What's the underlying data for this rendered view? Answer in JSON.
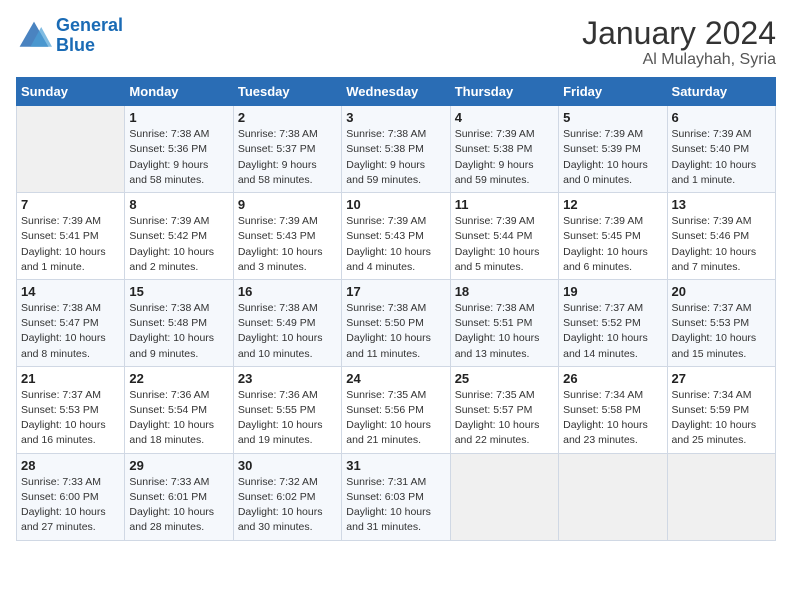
{
  "logo": {
    "line1": "General",
    "line2": "Blue"
  },
  "title": "January 2024",
  "location": "Al Mulayhah, Syria",
  "days_of_week": [
    "Sunday",
    "Monday",
    "Tuesday",
    "Wednesday",
    "Thursday",
    "Friday",
    "Saturday"
  ],
  "weeks": [
    [
      {
        "day": "",
        "info": ""
      },
      {
        "day": "1",
        "info": "Sunrise: 7:38 AM\nSunset: 5:36 PM\nDaylight: 9 hours\nand 58 minutes."
      },
      {
        "day": "2",
        "info": "Sunrise: 7:38 AM\nSunset: 5:37 PM\nDaylight: 9 hours\nand 58 minutes."
      },
      {
        "day": "3",
        "info": "Sunrise: 7:38 AM\nSunset: 5:38 PM\nDaylight: 9 hours\nand 59 minutes."
      },
      {
        "day": "4",
        "info": "Sunrise: 7:39 AM\nSunset: 5:38 PM\nDaylight: 9 hours\nand 59 minutes."
      },
      {
        "day": "5",
        "info": "Sunrise: 7:39 AM\nSunset: 5:39 PM\nDaylight: 10 hours\nand 0 minutes."
      },
      {
        "day": "6",
        "info": "Sunrise: 7:39 AM\nSunset: 5:40 PM\nDaylight: 10 hours\nand 1 minute."
      }
    ],
    [
      {
        "day": "7",
        "info": "Sunrise: 7:39 AM\nSunset: 5:41 PM\nDaylight: 10 hours\nand 1 minute."
      },
      {
        "day": "8",
        "info": "Sunrise: 7:39 AM\nSunset: 5:42 PM\nDaylight: 10 hours\nand 2 minutes."
      },
      {
        "day": "9",
        "info": "Sunrise: 7:39 AM\nSunset: 5:43 PM\nDaylight: 10 hours\nand 3 minutes."
      },
      {
        "day": "10",
        "info": "Sunrise: 7:39 AM\nSunset: 5:43 PM\nDaylight: 10 hours\nand 4 minutes."
      },
      {
        "day": "11",
        "info": "Sunrise: 7:39 AM\nSunset: 5:44 PM\nDaylight: 10 hours\nand 5 minutes."
      },
      {
        "day": "12",
        "info": "Sunrise: 7:39 AM\nSunset: 5:45 PM\nDaylight: 10 hours\nand 6 minutes."
      },
      {
        "day": "13",
        "info": "Sunrise: 7:39 AM\nSunset: 5:46 PM\nDaylight: 10 hours\nand 7 minutes."
      }
    ],
    [
      {
        "day": "14",
        "info": "Sunrise: 7:38 AM\nSunset: 5:47 PM\nDaylight: 10 hours\nand 8 minutes."
      },
      {
        "day": "15",
        "info": "Sunrise: 7:38 AM\nSunset: 5:48 PM\nDaylight: 10 hours\nand 9 minutes."
      },
      {
        "day": "16",
        "info": "Sunrise: 7:38 AM\nSunset: 5:49 PM\nDaylight: 10 hours\nand 10 minutes."
      },
      {
        "day": "17",
        "info": "Sunrise: 7:38 AM\nSunset: 5:50 PM\nDaylight: 10 hours\nand 11 minutes."
      },
      {
        "day": "18",
        "info": "Sunrise: 7:38 AM\nSunset: 5:51 PM\nDaylight: 10 hours\nand 13 minutes."
      },
      {
        "day": "19",
        "info": "Sunrise: 7:37 AM\nSunset: 5:52 PM\nDaylight: 10 hours\nand 14 minutes."
      },
      {
        "day": "20",
        "info": "Sunrise: 7:37 AM\nSunset: 5:53 PM\nDaylight: 10 hours\nand 15 minutes."
      }
    ],
    [
      {
        "day": "21",
        "info": "Sunrise: 7:37 AM\nSunset: 5:53 PM\nDaylight: 10 hours\nand 16 minutes."
      },
      {
        "day": "22",
        "info": "Sunrise: 7:36 AM\nSunset: 5:54 PM\nDaylight: 10 hours\nand 18 minutes."
      },
      {
        "day": "23",
        "info": "Sunrise: 7:36 AM\nSunset: 5:55 PM\nDaylight: 10 hours\nand 19 minutes."
      },
      {
        "day": "24",
        "info": "Sunrise: 7:35 AM\nSunset: 5:56 PM\nDaylight: 10 hours\nand 21 minutes."
      },
      {
        "day": "25",
        "info": "Sunrise: 7:35 AM\nSunset: 5:57 PM\nDaylight: 10 hours\nand 22 minutes."
      },
      {
        "day": "26",
        "info": "Sunrise: 7:34 AM\nSunset: 5:58 PM\nDaylight: 10 hours\nand 23 minutes."
      },
      {
        "day": "27",
        "info": "Sunrise: 7:34 AM\nSunset: 5:59 PM\nDaylight: 10 hours\nand 25 minutes."
      }
    ],
    [
      {
        "day": "28",
        "info": "Sunrise: 7:33 AM\nSunset: 6:00 PM\nDaylight: 10 hours\nand 27 minutes."
      },
      {
        "day": "29",
        "info": "Sunrise: 7:33 AM\nSunset: 6:01 PM\nDaylight: 10 hours\nand 28 minutes."
      },
      {
        "day": "30",
        "info": "Sunrise: 7:32 AM\nSunset: 6:02 PM\nDaylight: 10 hours\nand 30 minutes."
      },
      {
        "day": "31",
        "info": "Sunrise: 7:31 AM\nSunset: 6:03 PM\nDaylight: 10 hours\nand 31 minutes."
      },
      {
        "day": "",
        "info": ""
      },
      {
        "day": "",
        "info": ""
      },
      {
        "day": "",
        "info": ""
      }
    ]
  ]
}
